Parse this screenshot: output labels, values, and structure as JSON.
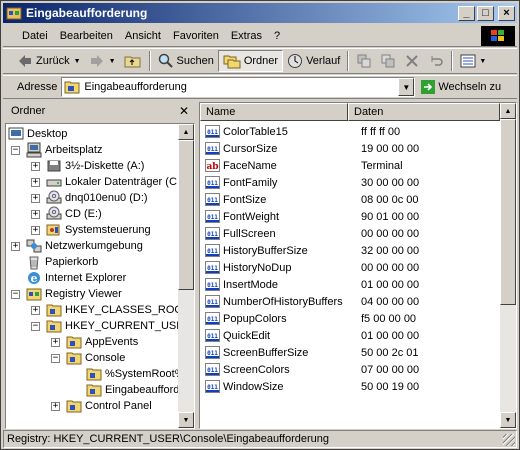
{
  "window": {
    "title": "Eingabeaufforderung"
  },
  "menu": [
    "Datei",
    "Bearbeiten",
    "Ansicht",
    "Favoriten",
    "Extras",
    "?"
  ],
  "toolbar": {
    "back": "Zurück",
    "search": "Suchen",
    "folders": "Ordner",
    "history": "Verlauf"
  },
  "address": {
    "label": "Adresse",
    "value": "Eingabeaufforderung",
    "go": "Wechseln zu"
  },
  "folders": {
    "title": "Ordner",
    "items": [
      "Desktop",
      "Arbeitsplatz",
      "3½-Diskette (A:)",
      "Lokaler Datenträger (C",
      "dnq010enu0 (D:)",
      "CD (E:)",
      "Systemsteuerung",
      "Netzwerkumgebung",
      "Papierkorb",
      "Internet Explorer",
      "Registry Viewer",
      "HKEY_CLASSES_ROOT",
      "HKEY_CURRENT_USER",
      "AppEvents",
      "Console",
      "%SystemRoot%",
      "Eingabeaufforderung",
      "Control Panel"
    ]
  },
  "list": {
    "columns": [
      "Name",
      "Daten"
    ],
    "rows": [
      {
        "name": "ColorTable15",
        "data": "ff ff ff 00",
        "type": "bin"
      },
      {
        "name": "CursorSize",
        "data": "19 00 00 00",
        "type": "bin"
      },
      {
        "name": "FaceName",
        "data": "Terminal",
        "type": "str"
      },
      {
        "name": "FontFamily",
        "data": "30 00 00 00",
        "type": "bin"
      },
      {
        "name": "FontSize",
        "data": "08 00 0c 00",
        "type": "bin"
      },
      {
        "name": "FontWeight",
        "data": "90 01 00 00",
        "type": "bin"
      },
      {
        "name": "FullScreen",
        "data": "00 00 00 00",
        "type": "bin"
      },
      {
        "name": "HistoryBufferSize",
        "data": "32 00 00 00",
        "type": "bin"
      },
      {
        "name": "HistoryNoDup",
        "data": "00 00 00 00",
        "type": "bin"
      },
      {
        "name": "InsertMode",
        "data": "01 00 00 00",
        "type": "bin"
      },
      {
        "name": "NumberOfHistoryBuffers",
        "data": "04 00 00 00",
        "type": "bin"
      },
      {
        "name": "PopupColors",
        "data": "f5 00 00 00",
        "type": "bin"
      },
      {
        "name": "QuickEdit",
        "data": "01 00 00 00",
        "type": "bin"
      },
      {
        "name": "ScreenBufferSize",
        "data": "50 00 2c 01",
        "type": "bin"
      },
      {
        "name": "ScreenColors",
        "data": "07 00 00 00",
        "type": "bin"
      },
      {
        "name": "WindowSize",
        "data": "50 00 19 00",
        "type": "bin"
      }
    ]
  },
  "status": {
    "text": "Registry: HKEY_CURRENT_USER\\Console\\Eingabeaufforderung"
  }
}
